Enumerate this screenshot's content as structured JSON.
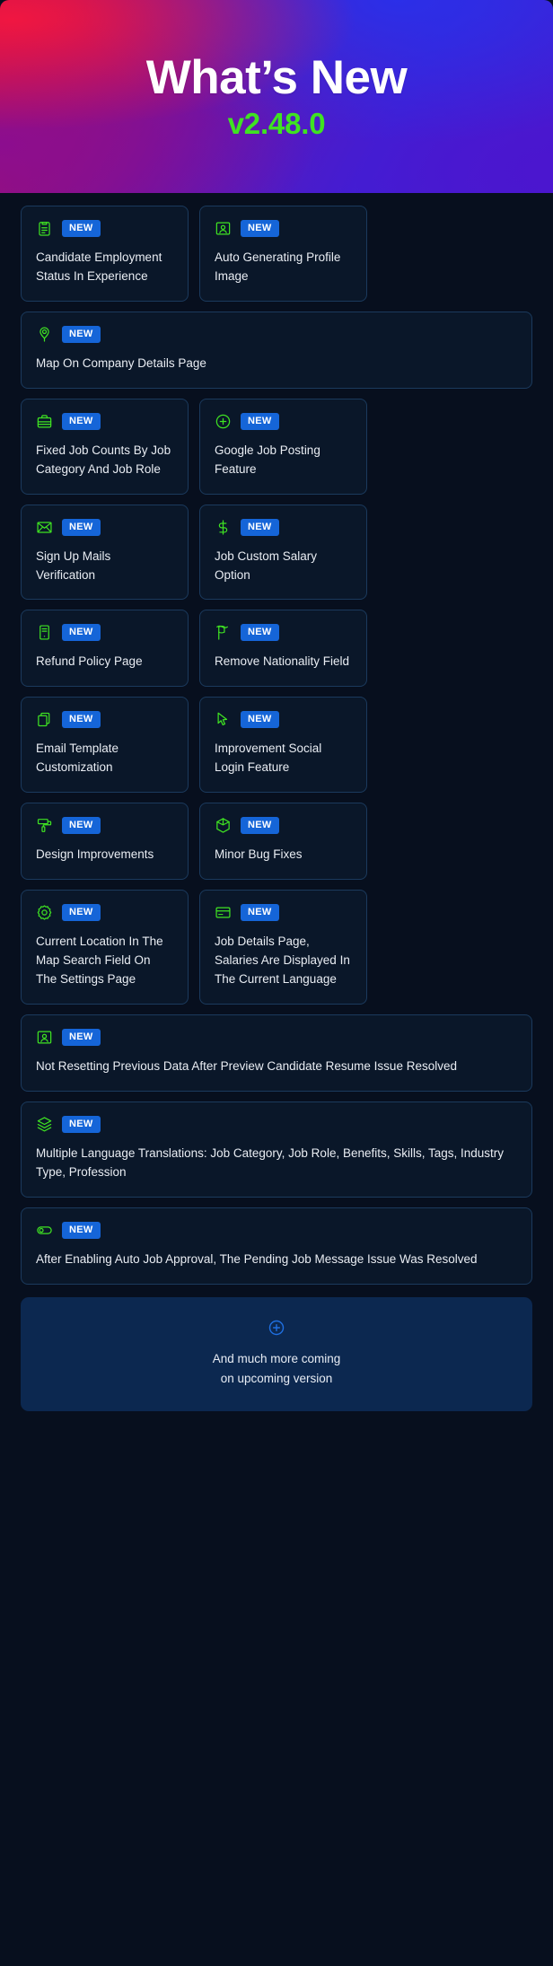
{
  "header": {
    "title": "What’s New",
    "version": "v2.48.0",
    "gradient_from": "#f01641",
    "gradient_to": "#4a19cd",
    "version_color": "#3fe322"
  },
  "colors": {
    "page_background": "#070f1e",
    "card_background": "#0a1729",
    "card_border": "#1b3a5d",
    "badge_background": "#1565d8",
    "icon_green": "#3fe322",
    "footer_background": "#0c2850",
    "footer_icon_blue": "#1f6fe0"
  },
  "badge_label": "NEW",
  "items": [
    {
      "icon": "clipboard-icon",
      "badge": "NEW",
      "title": "Candidate Employment Status In Experience",
      "width": "half"
    },
    {
      "icon": "profile-image-icon",
      "badge": "NEW",
      "title": "Auto Generating Profile Image",
      "width": "half"
    },
    {
      "icon": "map-pin-icon",
      "badge": "NEW",
      "title": "Map On Company Details Page",
      "width": "full"
    },
    {
      "icon": "briefcase-icon",
      "badge": "NEW",
      "title": "Fixed Job Counts By Job Category And Job Role",
      "width": "half"
    },
    {
      "icon": "plus-circle-icon",
      "badge": "NEW",
      "title": "Google Job Posting Feature",
      "width": "half"
    },
    {
      "icon": "envelope-icon",
      "badge": "NEW",
      "title": "Sign Up Mails Verification",
      "width": "half"
    },
    {
      "icon": "dollar-icon",
      "badge": "NEW",
      "title": "Job Custom Salary Option",
      "width": "half"
    },
    {
      "icon": "document-icon",
      "badge": "NEW",
      "title": "Refund Policy Page",
      "width": "half"
    },
    {
      "icon": "flag-icon",
      "badge": "NEW",
      "title": "Remove Nationality Field",
      "width": "half"
    },
    {
      "icon": "copy-icon",
      "badge": "NEW",
      "title": "Email Template Customization",
      "width": "half"
    },
    {
      "icon": "cursor-icon",
      "badge": "NEW",
      "title": "Improvement Social Login Feature",
      "width": "half"
    },
    {
      "icon": "paint-roller-icon",
      "badge": "NEW",
      "title": "Design Improvements",
      "width": "half"
    },
    {
      "icon": "cube-icon",
      "badge": "NEW",
      "title": "Minor Bug Fixes",
      "width": "half"
    },
    {
      "icon": "gear-icon",
      "badge": "NEW",
      "title": "Current Location In The Map Search Field On The Settings Page",
      "width": "half"
    },
    {
      "icon": "credit-card-icon",
      "badge": "NEW",
      "title": "Job Details Page, Salaries Are Displayed In The Current Language",
      "width": "half"
    },
    {
      "icon": "profile-image-icon",
      "badge": "NEW",
      "title": "Not Resetting Previous Data After Preview Candidate Resume Issue Resolved",
      "width": "full"
    },
    {
      "icon": "layers-icon",
      "badge": "NEW",
      "title": "Multiple Language Translations: Job Category, Job Role, Benefits, Skills, Tags, Industry Type, Profession",
      "width": "full"
    },
    {
      "icon": "toggle-icon",
      "badge": "NEW",
      "title": "After Enabling Auto Job Approval, The Pending Job Message Issue Was Resolved",
      "width": "full"
    }
  ],
  "footer": {
    "icon": "plus-circle-icon",
    "line1": "And much more coming",
    "line2": "on upcoming version"
  }
}
